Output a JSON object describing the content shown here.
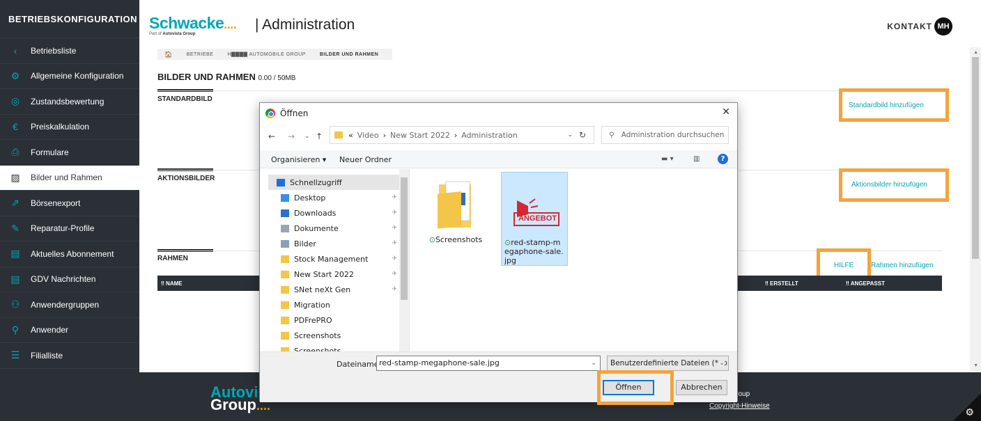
{
  "sidebar": {
    "title": "BETRIEBSKONFIGURATION",
    "items": [
      {
        "label": "Betriebsliste",
        "icon": "‹"
      },
      {
        "label": "Allgemeine Konfiguration",
        "icon": "⚙"
      },
      {
        "label": "Zustandsbewertung",
        "icon": "◎"
      },
      {
        "label": "Preiskalkulation",
        "icon": "€"
      },
      {
        "label": "Formulare",
        "icon": "⎙"
      },
      {
        "label": "Bilder und Rahmen",
        "icon": "▨"
      },
      {
        "label": "Börsenexport",
        "icon": "⇗"
      },
      {
        "label": "Reparatur-Profile",
        "icon": "✎"
      },
      {
        "label": "Aktuelles Abonnement",
        "icon": "▤"
      },
      {
        "label": "GDV Nachrichten",
        "icon": "▤"
      },
      {
        "label": "Anwendergruppen",
        "icon": "⚇"
      },
      {
        "label": "Anwender",
        "icon": "⚲"
      },
      {
        "label": "Filialliste",
        "icon": "☰"
      }
    ]
  },
  "header": {
    "logo": "Schwacke",
    "logo_dots": "....",
    "logo_sub_prefix": "Part of",
    "logo_sub_brand": "Autovista Group",
    "title": "| Administration",
    "kontakt": "KONTAKT",
    "avatar": "MH"
  },
  "breadcrumb": {
    "home": "🏠",
    "items": [
      "BETRIEBE",
      "H▇▇▇▇ AUTOMOBILE GROUP",
      "BILDER UND RAHMEN"
    ]
  },
  "page": {
    "title": "BILDER UND RAHMEN",
    "size": "0.00 / 50MB",
    "sections": [
      {
        "title": "STANDARDBILD",
        "action": "Standardbild hinzufügen"
      },
      {
        "title": "AKTIONSBILDER",
        "action": "Aktionsbilder hinzufügen"
      },
      {
        "title": "RAHMEN",
        "action": "Rahmen hinzufügen",
        "help": "HILFE"
      }
    ],
    "table_headers": [
      "‼ NAME",
      "‼ ERSTELLT",
      "‼ ANGEPASST"
    ]
  },
  "footer": {
    "logo_top": "Autovis",
    "logo_bottom": "Group",
    "company": "vista Group",
    "copyright": "Copyright-Hinweise"
  },
  "dialog": {
    "title": "Öffnen",
    "close": "✕",
    "path": [
      "«",
      "Video",
      "New Start 2022",
      "Administration"
    ],
    "search_placeholder": "Administration durchsuchen",
    "organize": "Organisieren ▾",
    "new_folder": "Neuer Ordner",
    "nav": [
      {
        "label": "Schnellzugriff",
        "color": "#1e6fd9",
        "pin": false
      },
      {
        "label": "Desktop",
        "color": "#3a8ee6",
        "pin": true
      },
      {
        "label": "Downloads",
        "color": "#2a6fc9",
        "pin": true
      },
      {
        "label": "Dokumente",
        "color": "#9aa5b1",
        "pin": true
      },
      {
        "label": "Bilder",
        "color": "#8aa0b8",
        "pin": true
      },
      {
        "label": "Stock Management",
        "color": "#f3c548",
        "pin": true
      },
      {
        "label": "New Start 2022",
        "color": "#f3c548",
        "pin": true
      },
      {
        "label": "SNet neXt Gen",
        "color": "#f3c548",
        "pin": true
      },
      {
        "label": "Migration",
        "color": "#f3c548",
        "pin": false
      },
      {
        "label": "PDFrePRO",
        "color": "#f3c548",
        "pin": false
      },
      {
        "label": "Screenshots",
        "color": "#f3c548",
        "pin": false
      },
      {
        "label": "Screenshots",
        "color": "#f3c548",
        "pin": false
      }
    ],
    "files": [
      {
        "name": "Screenshots"
      },
      {
        "name": "red-stamp-megaphone-sale.jpg",
        "thumb_text": "ANGEBOT"
      }
    ],
    "filename_label": "Dateiname:",
    "filename_value": "red-stamp-megaphone-sale.jpg",
    "filter": "Benutzerdefinierte Dateien (*.jp",
    "open": "Öffnen",
    "cancel": "Abbrechen"
  }
}
